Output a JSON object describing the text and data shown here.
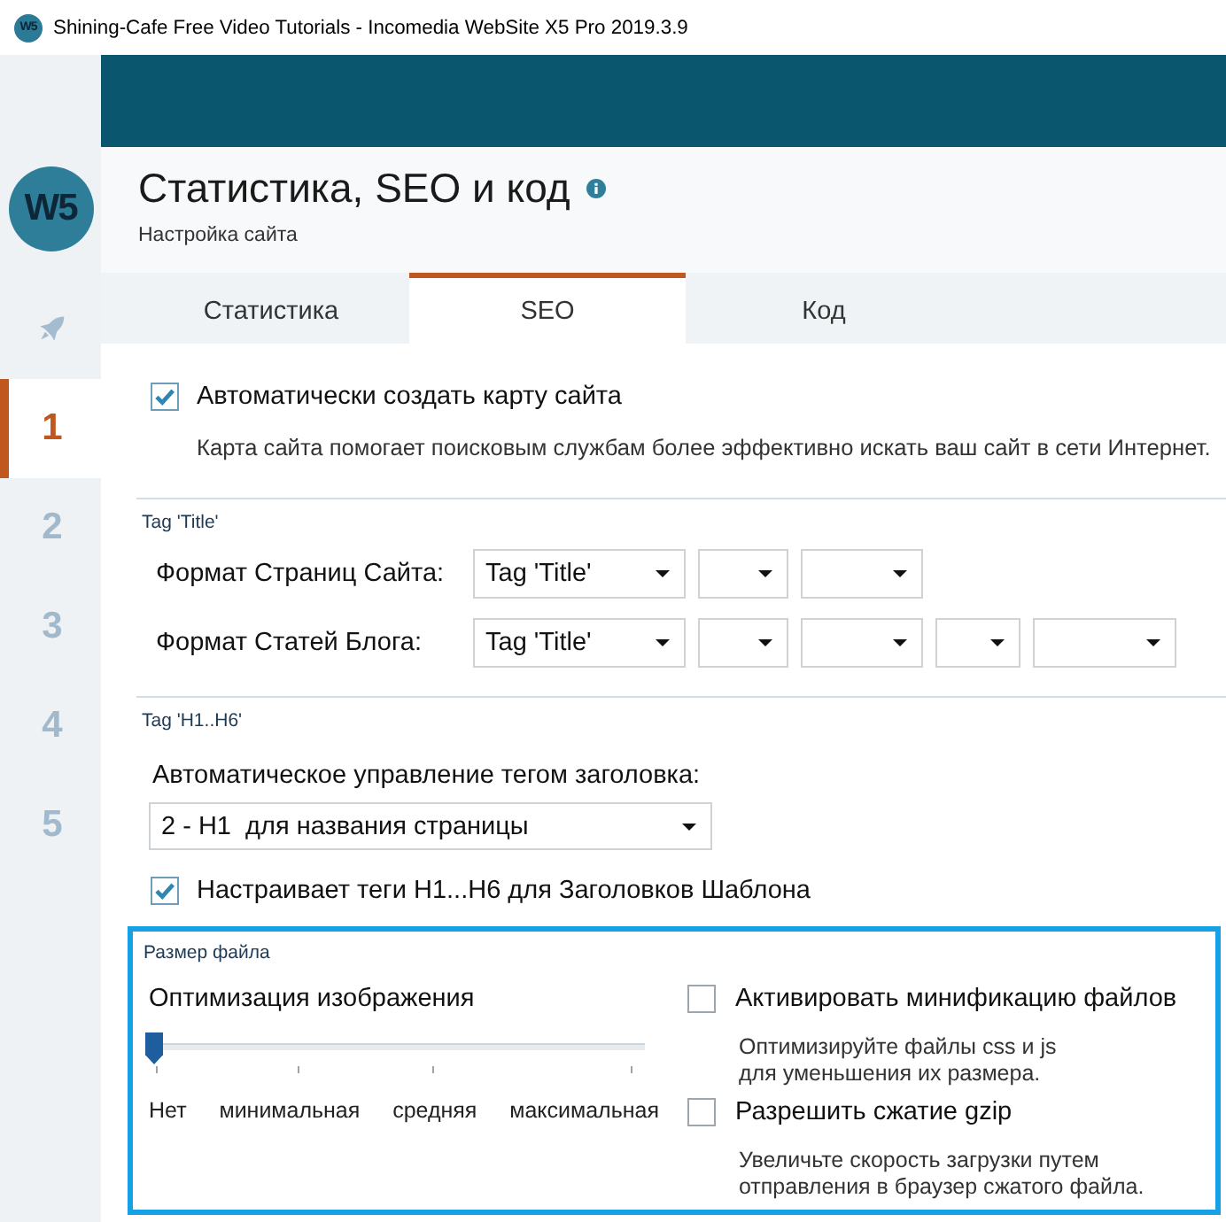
{
  "window": {
    "title": "Shining-Cafe Free Video Tutorials - Incomedia WebSite X5 Pro 2019.3.9",
    "icon_text": "W5"
  },
  "sidebar": {
    "logo": "W5",
    "items": [
      {
        "kind": "icon",
        "selected": false
      },
      {
        "kind": "step",
        "label": "1",
        "selected": true
      },
      {
        "kind": "step",
        "label": "2",
        "selected": false
      },
      {
        "kind": "step",
        "label": "3",
        "selected": false
      },
      {
        "kind": "step",
        "label": "4",
        "selected": false
      },
      {
        "kind": "step",
        "label": "5",
        "selected": false
      }
    ]
  },
  "page": {
    "title": "Статистика, SEO и код",
    "subtitle": "Настройка сайта"
  },
  "tabs": [
    {
      "label": "Статистика",
      "selected": false
    },
    {
      "label": "SEO",
      "selected": true
    },
    {
      "label": "Код",
      "selected": false
    }
  ],
  "sitemap": {
    "label": "Автоматически создать карту сайта",
    "checked": true,
    "description": "Карта сайта помогает поисковым службам более эффективно искать ваш сайт в сети Интернет."
  },
  "title_tag": {
    "heading": "Tag 'Title'",
    "rows": [
      {
        "label": "Формат Страниц Сайта:",
        "dropdowns": [
          {
            "kind": "filled",
            "value": "Tag 'Title'"
          },
          {
            "kind": "empty"
          },
          {
            "kind": "empty"
          }
        ]
      },
      {
        "label": "Формат Статей Блога:",
        "dropdowns": [
          {
            "kind": "filled",
            "value": "Tag 'Title'"
          },
          {
            "kind": "empty"
          },
          {
            "kind": "empty"
          },
          {
            "kind": "empty"
          },
          {
            "kind": "empty"
          }
        ]
      }
    ]
  },
  "heading_tag": {
    "heading": "Tag 'H1..H6'",
    "label": "Автоматическое управление тегом заголовка:",
    "dropdown": "2 - H1  для названия страницы",
    "template": {
      "label": "Настраивает теги H1...H6 для Заголовков Шаблона",
      "checked": true
    }
  },
  "file_size": {
    "heading": "Размер файла",
    "highlighted": true,
    "optimization": {
      "label": "Оптимизация изображения",
      "level": 0,
      "ticks": [
        "Нет",
        "минимальная",
        "средняя",
        "максимальная"
      ]
    },
    "options": [
      {
        "label": "Активировать минификацию файлов",
        "checked": false,
        "description": [
          "Оптимизируйте файлы css и js",
          "для уменьшения их размера."
        ]
      },
      {
        "label": "Разрешить сжатие gzip",
        "checked": false,
        "description": [
          "Увеличьте скорость загрузки путем",
          "отправления в браузер сжатого файла."
        ]
      }
    ]
  }
}
